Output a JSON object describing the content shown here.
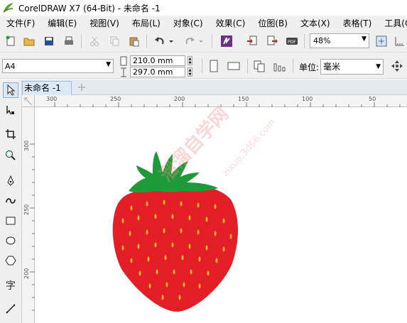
{
  "window": {
    "title": "CorelDRAW X7 (64-Bit) - 未命名 -1"
  },
  "menu": [
    "文件(F)",
    "编辑(E)",
    "视图(V)",
    "布局(L)",
    "对象(C)",
    "效果(C)",
    "位图(B)",
    "文本(X)",
    "表格(T)",
    "工具(O)"
  ],
  "toolbar": {
    "zoom": "48%"
  },
  "property_bar": {
    "page_size": "A4",
    "width": "210.0 mm",
    "height": "297.0 mm",
    "unit_label": "单位:",
    "unit": "毫米"
  },
  "document": {
    "tab_label": "未命名 -1",
    "add_tab": "+"
  },
  "rulers": {
    "horizontal": [
      "300",
      "250",
      "200",
      "150",
      "100",
      "50"
    ],
    "vertical": [
      "300",
      "250",
      "200"
    ]
  },
  "watermark": {
    "text": "溜溜自学网",
    "url": "zixue.3d66.com"
  },
  "colors": {
    "berry": "#e41e26",
    "leaves": "#1f9a3a",
    "seeds": "#f7b42c"
  }
}
